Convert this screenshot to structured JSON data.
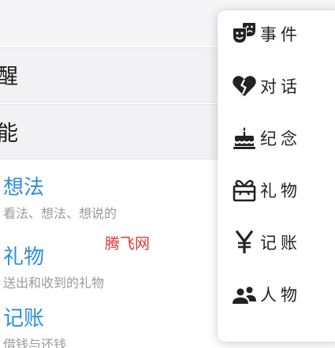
{
  "list": {
    "rows": [
      {
        "text": "醒"
      },
      {
        "text": "能"
      }
    ],
    "items": [
      {
        "title": "想法",
        "desc": "看法、想法、想说的"
      },
      {
        "title": "礼物",
        "desc": "送出和收到的礼物"
      },
      {
        "title": "记账",
        "desc": "借钱与还钱"
      }
    ]
  },
  "watermark": "腾飞网",
  "menu": {
    "items": [
      {
        "label": "事件",
        "icon": "theater-masks-icon"
      },
      {
        "label": "对话",
        "icon": "broken-heart-icon"
      },
      {
        "label": "纪念",
        "icon": "birthday-cake-icon"
      },
      {
        "label": "礼物",
        "icon": "gift-icon"
      },
      {
        "label": "记账",
        "icon": "yen-icon"
      },
      {
        "label": "人物",
        "icon": "people-icon"
      }
    ]
  },
  "colors": {
    "accent": "#2c8de2",
    "watermark": "#e03535",
    "desc": "#9a9a9a"
  }
}
